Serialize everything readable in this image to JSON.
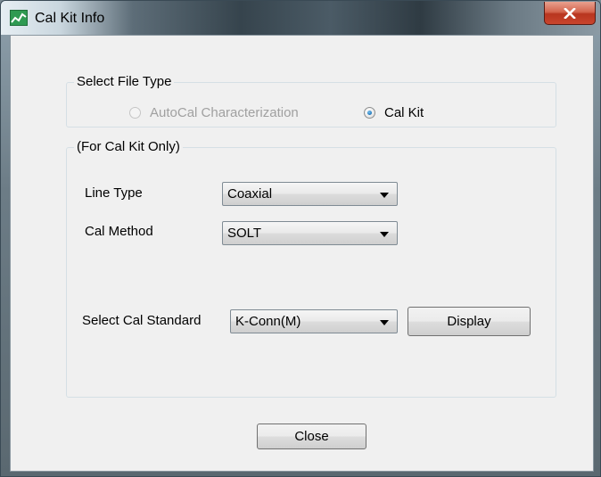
{
  "window": {
    "title": "Cal Kit Info"
  },
  "file_type_group": {
    "legend": "Select File Type",
    "options": [
      {
        "label": "AutoCal Characterization",
        "selected": false,
        "disabled": true
      },
      {
        "label": "Cal Kit",
        "selected": true,
        "disabled": false
      }
    ]
  },
  "cal_kit_group": {
    "legend": "(For Cal Kit Only)",
    "line_type": {
      "label": "Line Type",
      "value": "Coaxial"
    },
    "cal_method": {
      "label": "Cal Method",
      "value": "SOLT"
    },
    "cal_standard": {
      "label": "Select Cal Standard",
      "value": "K-Conn(M)"
    },
    "display_button": "Display"
  },
  "close_button": "Close",
  "icons": {
    "app": "calibration-app-icon",
    "close": "close-icon",
    "dropdown": "chevron-down-icon"
  }
}
